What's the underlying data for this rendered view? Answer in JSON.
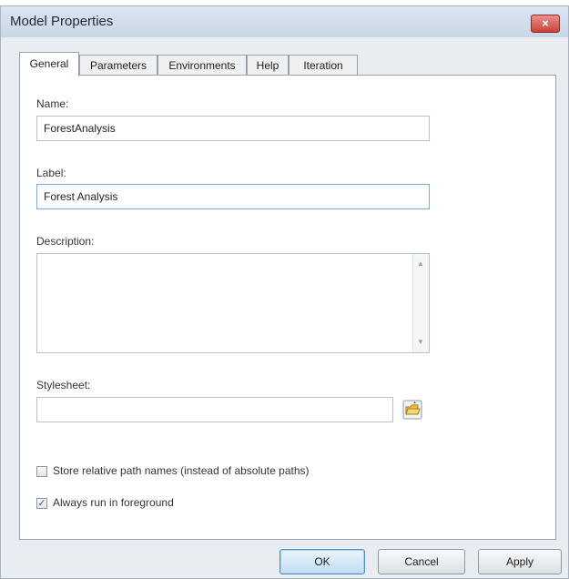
{
  "window": {
    "title": "Model Properties",
    "close_label": "×"
  },
  "tabs": [
    {
      "label": "General",
      "active": true
    },
    {
      "label": "Parameters",
      "active": false
    },
    {
      "label": "Environments",
      "active": false
    },
    {
      "label": "Help",
      "active": false
    },
    {
      "label": "Iteration",
      "active": false
    }
  ],
  "form": {
    "name_label": "Name:",
    "name_value": "ForestAnalysis",
    "label_label": "Label:",
    "label_value": "Forest Analysis",
    "description_label": "Description:",
    "description_value": "",
    "stylesheet_label": "Stylesheet:",
    "stylesheet_value": ""
  },
  "checkboxes": [
    {
      "label": "Store relative path names (instead of absolute paths)",
      "checked": false
    },
    {
      "label": "Always run in foreground",
      "checked": true
    }
  ],
  "buttons": {
    "ok": "OK",
    "cancel": "Cancel",
    "apply": "Apply"
  },
  "icons": {
    "close": "close-icon",
    "browse": "folder-browse-icon",
    "scroll_up": "scroll-up-icon",
    "scroll_down": "scroll-down-icon"
  },
  "colors": {
    "close_red": "#c9443b",
    "focus_border": "#7ea8d3",
    "default_button": "#4d8fc8"
  }
}
